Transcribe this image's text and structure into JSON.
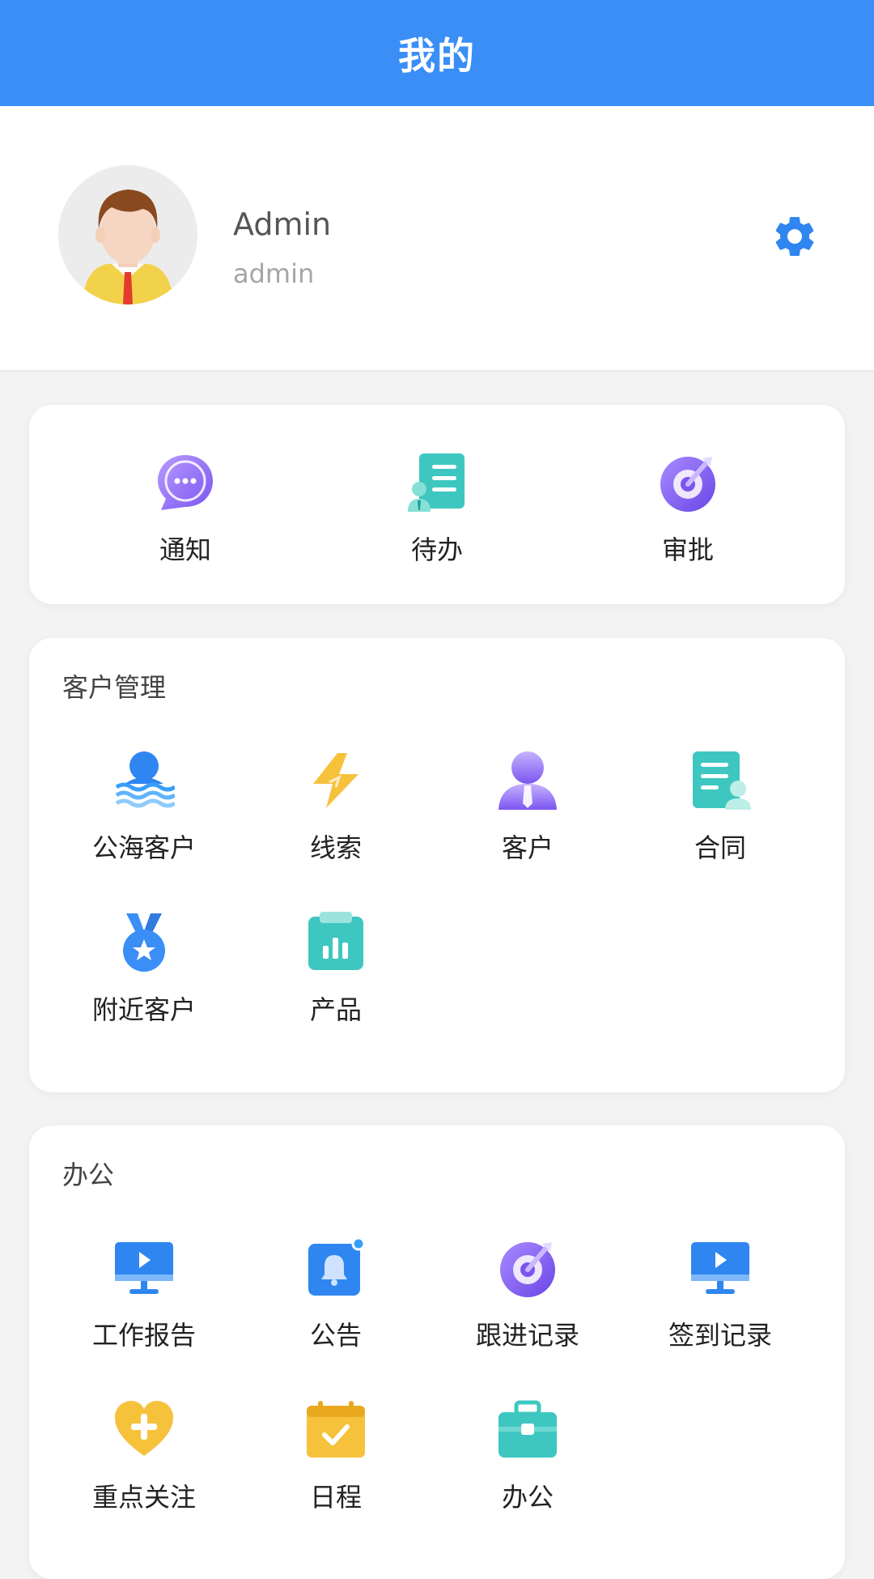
{
  "header": {
    "title": "我的"
  },
  "profile": {
    "name": "Admin",
    "account": "admin"
  },
  "quick": [
    {
      "label": "通知",
      "icon": "chat-bubble-icon"
    },
    {
      "label": "待办",
      "icon": "todo-list-icon"
    },
    {
      "label": "审批",
      "icon": "target-icon"
    }
  ],
  "customer": {
    "title": "客户管理",
    "items": [
      {
        "label": "公海客户",
        "icon": "sea-customer-icon"
      },
      {
        "label": "线索",
        "icon": "lightning-icon"
      },
      {
        "label": "客户",
        "icon": "person-tie-icon"
      },
      {
        "label": "合同",
        "icon": "contract-icon"
      },
      {
        "label": "附近客户",
        "icon": "medal-icon"
      },
      {
        "label": "产品",
        "icon": "product-chart-icon"
      }
    ]
  },
  "office": {
    "title": "办公",
    "items": [
      {
        "label": "工作报告",
        "icon": "monitor-play-icon"
      },
      {
        "label": "公告",
        "icon": "bell-icon"
      },
      {
        "label": "跟进记录",
        "icon": "target-icon"
      },
      {
        "label": "签到记录",
        "icon": "monitor-play-icon"
      },
      {
        "label": "重点关注",
        "icon": "heart-plus-icon"
      },
      {
        "label": "日程",
        "icon": "calendar-check-icon"
      },
      {
        "label": "办公",
        "icon": "briefcase-icon"
      }
    ]
  },
  "colors": {
    "primary": "#3a8ef6",
    "background": "#f3f3f3"
  }
}
